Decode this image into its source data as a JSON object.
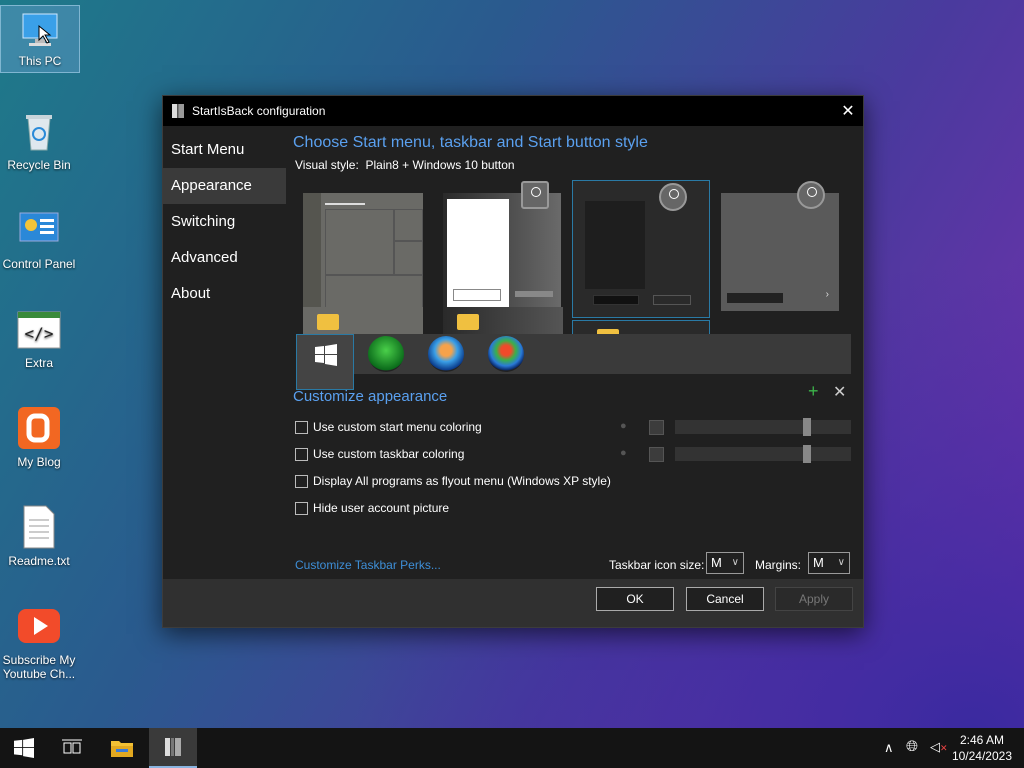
{
  "desktop": {
    "icons": [
      {
        "label": "This PC"
      },
      {
        "label": "Recycle Bin"
      },
      {
        "label": "Control Panel"
      },
      {
        "label": "Extra"
      },
      {
        "label": "My Blog"
      },
      {
        "label": "Readme.txt"
      },
      {
        "label": "Subscribe My Youtube Ch..."
      }
    ]
  },
  "window": {
    "title": "StartIsBack configuration",
    "nav": [
      "Start Menu",
      "Appearance",
      "Switching",
      "Advanced",
      "About"
    ],
    "active_nav": "Appearance",
    "heading": "Choose Start menu, taskbar and Start button style",
    "visual_style_label": "Visual style:",
    "visual_style_value": "Plain8 + Windows 10 button",
    "customize_heading": "Customize appearance",
    "checkboxes": [
      "Use custom start menu coloring",
      "Use custom taskbar coloring",
      "Display All programs as flyout menu (Windows XP style)",
      "Hide user account picture"
    ],
    "perks_link": "Customize Taskbar Perks...",
    "icon_size_label": "Taskbar icon size:",
    "icon_size_value": "M",
    "margins_label": "Margins:",
    "margins_value": "M",
    "buttons": {
      "ok": "OK",
      "cancel": "Cancel",
      "apply": "Apply"
    }
  },
  "taskbar": {
    "time": "2:46 AM",
    "date": "10/24/2023"
  },
  "colors": {
    "accent": "#5aa0ef",
    "link": "#3e8fd8"
  }
}
